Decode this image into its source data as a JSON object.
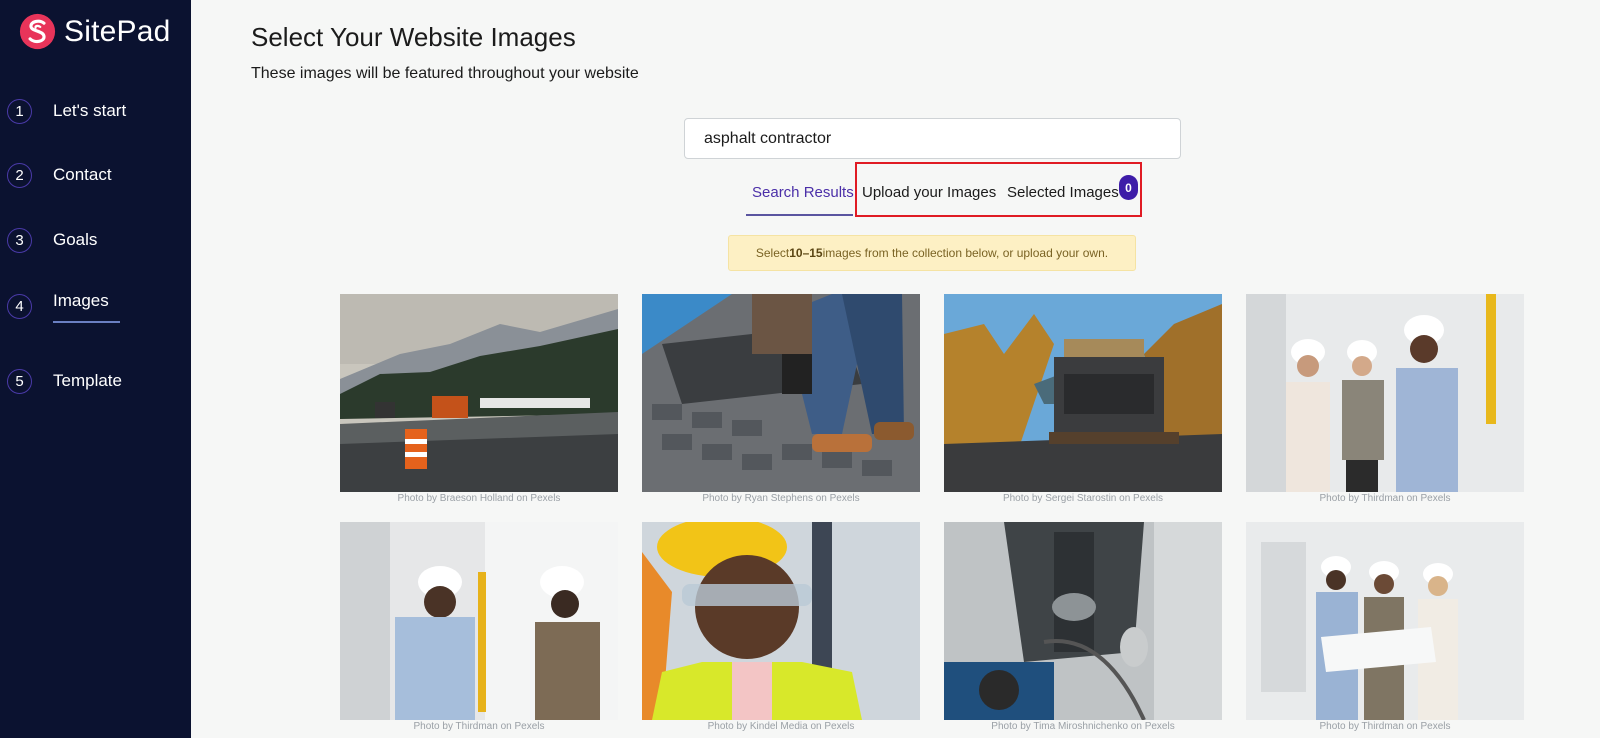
{
  "brand": {
    "name": "SitePad"
  },
  "steps": [
    {
      "num": "1",
      "label": "Let's start"
    },
    {
      "num": "2",
      "label": "Contact"
    },
    {
      "num": "3",
      "label": "Goals"
    },
    {
      "num": "4",
      "label": "Images"
    },
    {
      "num": "5",
      "label": "Template"
    }
  ],
  "page": {
    "title": "Select Your Website Images",
    "subtitle": "These images will be featured throughout your website"
  },
  "search": {
    "value": "asphalt contractor"
  },
  "tabs": {
    "search_results": "Search Results",
    "upload": "Upload your Images",
    "selected": "Selected Images",
    "selected_count": "0"
  },
  "notice": {
    "before": "Select ",
    "bold": "10–15",
    "after": " images from the collection below, or upload your own."
  },
  "photos": [
    {
      "credit": "Photo by Braeson Holland on Pexels"
    },
    {
      "credit": "Photo by Ryan Stephens on Pexels"
    },
    {
      "credit": "Photo by Sergei Starostin on Pexels"
    },
    {
      "credit": "Photo by Thirdman on Pexels"
    },
    {
      "credit": "Photo by Thirdman on Pexels"
    },
    {
      "credit": "Photo by Kindel Media on Pexels"
    },
    {
      "credit": "Photo by Tima Miroshnichenko on Pexels"
    },
    {
      "credit": "Photo by Thirdman on Pexels"
    }
  ],
  "colors": {
    "sidebar": "#0b1230",
    "accent": "#4b2fa8",
    "highlight": "#e01b24",
    "logo": "#e8345a"
  }
}
